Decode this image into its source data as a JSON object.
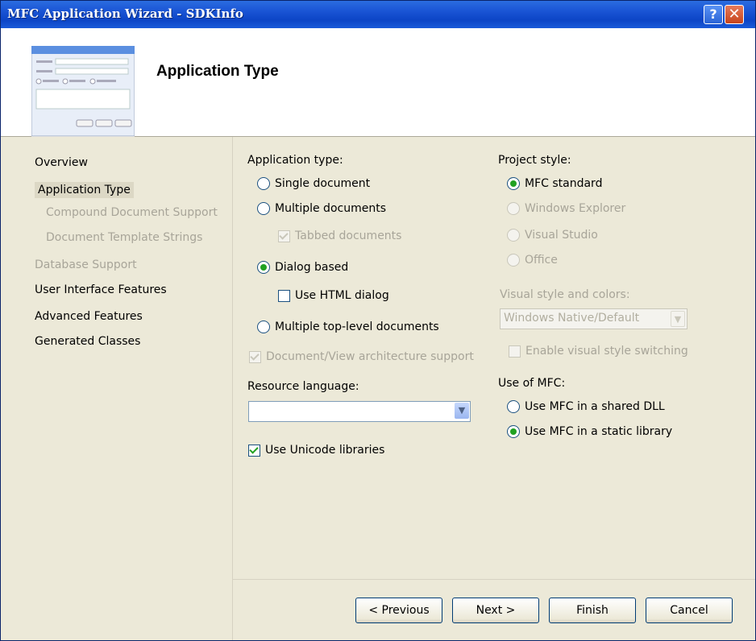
{
  "window": {
    "title": "MFC Application Wizard - SDKInfo",
    "help_glyph": "?",
    "close_glyph": "✕"
  },
  "header": {
    "title": "Application Type"
  },
  "nav": {
    "overview": "Overview",
    "application_type": "Application Type",
    "compound_document_support": "Compound Document Support",
    "document_template_strings": "Document Template Strings",
    "database_support": "Database Support",
    "user_interface_features": "User Interface Features",
    "advanced_features": "Advanced Features",
    "generated_classes": "Generated Classes"
  },
  "app_type": {
    "label": "Application type:",
    "single_document": "Single document",
    "multiple_documents": "Multiple documents",
    "tabbed_documents": "Tabbed documents",
    "dialog_based": "Dialog based",
    "use_html_dialog": "Use HTML dialog",
    "multiple_top_level": "Multiple top-level documents",
    "doc_view_support": "Document/View architecture support",
    "selected": "Dialog based"
  },
  "resource_language": {
    "label": "Resource language:",
    "value": ""
  },
  "unicode": {
    "label": "Use Unicode libraries",
    "checked": true
  },
  "project_style": {
    "label": "Project style:",
    "mfc_standard": "MFC standard",
    "windows_explorer": "Windows Explorer",
    "visual_studio": "Visual Studio",
    "office": "Office",
    "selected": "MFC standard"
  },
  "visual_style": {
    "label": "Visual style and colors:",
    "value": "Windows Native/Default",
    "enable_switching": "Enable visual style switching"
  },
  "use_of_mfc": {
    "label": "Use of MFC:",
    "shared_dll": "Use MFC in a shared DLL",
    "static_library": "Use MFC in a static library",
    "selected": "Use MFC in a static library"
  },
  "buttons": {
    "previous": "< Previous",
    "next": "Next >",
    "finish": "Finish",
    "cancel": "Cancel"
  },
  "colors": {
    "titlebar": "#0c45c6",
    "face": "#ece9d8",
    "radio_dot": "#21a121",
    "disabled_text": "#a8a599"
  }
}
